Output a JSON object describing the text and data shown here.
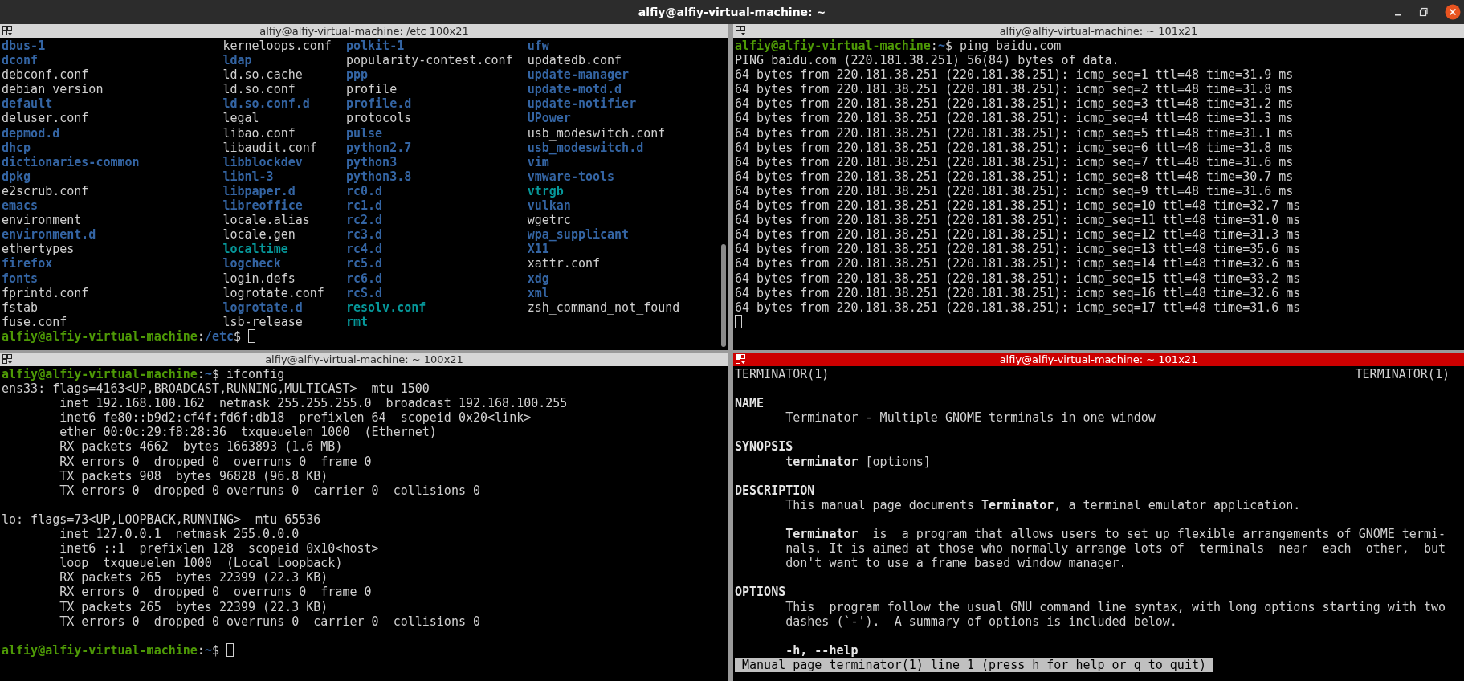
{
  "window": {
    "title": "alfiy@alfiy-virtual-machine: ~"
  },
  "panes": [
    {
      "title": "alfiy@alfiy-virtual-machine: /etc 100x21",
      "focused": false,
      "scrollbar": true,
      "listing": [
        [
          {
            "name": "dbus-1",
            "kind": "dir"
          },
          {
            "name": "kerneloops.conf",
            "kind": "file"
          },
          {
            "name": "polkit-1",
            "kind": "dir"
          },
          {
            "name": "ufw",
            "kind": "dir"
          }
        ],
        [
          {
            "name": "dconf",
            "kind": "dir"
          },
          {
            "name": "ldap",
            "kind": "dir"
          },
          {
            "name": "popularity-contest.conf",
            "kind": "file"
          },
          {
            "name": "updatedb.conf",
            "kind": "file"
          }
        ],
        [
          {
            "name": "debconf.conf",
            "kind": "file"
          },
          {
            "name": "ld.so.cache",
            "kind": "file"
          },
          {
            "name": "ppp",
            "kind": "dir"
          },
          {
            "name": "update-manager",
            "kind": "dir"
          }
        ],
        [
          {
            "name": "debian_version",
            "kind": "file"
          },
          {
            "name": "ld.so.conf",
            "kind": "file"
          },
          {
            "name": "profile",
            "kind": "file"
          },
          {
            "name": "update-motd.d",
            "kind": "dir"
          }
        ],
        [
          {
            "name": "default",
            "kind": "dir"
          },
          {
            "name": "ld.so.conf.d",
            "kind": "dir"
          },
          {
            "name": "profile.d",
            "kind": "dir"
          },
          {
            "name": "update-notifier",
            "kind": "dir"
          }
        ],
        [
          {
            "name": "deluser.conf",
            "kind": "file"
          },
          {
            "name": "legal",
            "kind": "file"
          },
          {
            "name": "protocols",
            "kind": "file"
          },
          {
            "name": "UPower",
            "kind": "dir"
          }
        ],
        [
          {
            "name": "depmod.d",
            "kind": "dir"
          },
          {
            "name": "libao.conf",
            "kind": "file"
          },
          {
            "name": "pulse",
            "kind": "dir"
          },
          {
            "name": "usb_modeswitch.conf",
            "kind": "file"
          }
        ],
        [
          {
            "name": "dhcp",
            "kind": "dir"
          },
          {
            "name": "libaudit.conf",
            "kind": "file"
          },
          {
            "name": "python2.7",
            "kind": "dir"
          },
          {
            "name": "usb_modeswitch.d",
            "kind": "dir"
          }
        ],
        [
          {
            "name": "dictionaries-common",
            "kind": "dir"
          },
          {
            "name": "libblockdev",
            "kind": "dir"
          },
          {
            "name": "python3",
            "kind": "dir"
          },
          {
            "name": "vim",
            "kind": "dir"
          }
        ],
        [
          {
            "name": "dpkg",
            "kind": "dir"
          },
          {
            "name": "libnl-3",
            "kind": "dir"
          },
          {
            "name": "python3.8",
            "kind": "dir"
          },
          {
            "name": "vmware-tools",
            "kind": "dir"
          }
        ],
        [
          {
            "name": "e2scrub.conf",
            "kind": "file"
          },
          {
            "name": "libpaper.d",
            "kind": "dir"
          },
          {
            "name": "rc0.d",
            "kind": "dir"
          },
          {
            "name": "vtrgb",
            "kind": "link"
          }
        ],
        [
          {
            "name": "emacs",
            "kind": "dir"
          },
          {
            "name": "libreoffice",
            "kind": "dir"
          },
          {
            "name": "rc1.d",
            "kind": "dir"
          },
          {
            "name": "vulkan",
            "kind": "dir"
          }
        ],
        [
          {
            "name": "environment",
            "kind": "file"
          },
          {
            "name": "locale.alias",
            "kind": "file"
          },
          {
            "name": "rc2.d",
            "kind": "dir"
          },
          {
            "name": "wgetrc",
            "kind": "file"
          }
        ],
        [
          {
            "name": "environment.d",
            "kind": "dir"
          },
          {
            "name": "locale.gen",
            "kind": "file"
          },
          {
            "name": "rc3.d",
            "kind": "dir"
          },
          {
            "name": "wpa_supplicant",
            "kind": "dir"
          }
        ],
        [
          {
            "name": "ethertypes",
            "kind": "file"
          },
          {
            "name": "localtime",
            "kind": "link"
          },
          {
            "name": "rc4.d",
            "kind": "dir"
          },
          {
            "name": "X11",
            "kind": "dir"
          }
        ],
        [
          {
            "name": "firefox",
            "kind": "dir"
          },
          {
            "name": "logcheck",
            "kind": "dir"
          },
          {
            "name": "rc5.d",
            "kind": "dir"
          },
          {
            "name": "xattr.conf",
            "kind": "file"
          }
        ],
        [
          {
            "name": "fonts",
            "kind": "dir"
          },
          {
            "name": "login.defs",
            "kind": "file"
          },
          {
            "name": "rc6.d",
            "kind": "dir"
          },
          {
            "name": "xdg",
            "kind": "dir"
          }
        ],
        [
          {
            "name": "fprintd.conf",
            "kind": "file"
          },
          {
            "name": "logrotate.conf",
            "kind": "file"
          },
          {
            "name": "rcS.d",
            "kind": "dir"
          },
          {
            "name": "xml",
            "kind": "dir"
          }
        ],
        [
          {
            "name": "fstab",
            "kind": "file"
          },
          {
            "name": "logrotate.d",
            "kind": "dir"
          },
          {
            "name": "resolv.conf",
            "kind": "link"
          },
          {
            "name": "zsh_command_not_found",
            "kind": "file"
          }
        ],
        [
          {
            "name": "fuse.conf",
            "kind": "file"
          },
          {
            "name": "lsb-release",
            "kind": "file"
          },
          {
            "name": "rmt",
            "kind": "link"
          }
        ]
      ],
      "lines": [
        {
          "kind": "prompt",
          "user": "alfiy@alfiy-virtual-machine",
          "separator": ":",
          "path": "/etc",
          "sign": "$",
          "cursor": true
        }
      ]
    },
    {
      "title": "alfiy@alfiy-virtual-machine: ~ 101x21",
      "focused": false,
      "scrollbar": false,
      "lines": [
        {
          "kind": "prompt",
          "user": "alfiy@alfiy-virtual-machine",
          "separator": ":",
          "path": "~",
          "sign": "$",
          "command": "ping baidu.com",
          "cursor": false
        },
        {
          "kind": "plain",
          "text": "PING baidu.com (220.181.38.251) 56(84) bytes of data."
        },
        {
          "kind": "plain",
          "text": "64 bytes from 220.181.38.251 (220.181.38.251): icmp_seq=1 ttl=48 time=31.9 ms"
        },
        {
          "kind": "plain",
          "text": "64 bytes from 220.181.38.251 (220.181.38.251): icmp_seq=2 ttl=48 time=31.8 ms"
        },
        {
          "kind": "plain",
          "text": "64 bytes from 220.181.38.251 (220.181.38.251): icmp_seq=3 ttl=48 time=31.2 ms"
        },
        {
          "kind": "plain",
          "text": "64 bytes from 220.181.38.251 (220.181.38.251): icmp_seq=4 ttl=48 time=31.3 ms"
        },
        {
          "kind": "plain",
          "text": "64 bytes from 220.181.38.251 (220.181.38.251): icmp_seq=5 ttl=48 time=31.1 ms"
        },
        {
          "kind": "plain",
          "text": "64 bytes from 220.181.38.251 (220.181.38.251): icmp_seq=6 ttl=48 time=31.8 ms"
        },
        {
          "kind": "plain",
          "text": "64 bytes from 220.181.38.251 (220.181.38.251): icmp_seq=7 ttl=48 time=31.6 ms"
        },
        {
          "kind": "plain",
          "text": "64 bytes from 220.181.38.251 (220.181.38.251): icmp_seq=8 ttl=48 time=30.7 ms"
        },
        {
          "kind": "plain",
          "text": "64 bytes from 220.181.38.251 (220.181.38.251): icmp_seq=9 ttl=48 time=31.6 ms"
        },
        {
          "kind": "plain",
          "text": "64 bytes from 220.181.38.251 (220.181.38.251): icmp_seq=10 ttl=48 time=32.7 ms"
        },
        {
          "kind": "plain",
          "text": "64 bytes from 220.181.38.251 (220.181.38.251): icmp_seq=11 ttl=48 time=31.0 ms"
        },
        {
          "kind": "plain",
          "text": "64 bytes from 220.181.38.251 (220.181.38.251): icmp_seq=12 ttl=48 time=31.3 ms"
        },
        {
          "kind": "plain",
          "text": "64 bytes from 220.181.38.251 (220.181.38.251): icmp_seq=13 ttl=48 time=35.6 ms"
        },
        {
          "kind": "plain",
          "text": "64 bytes from 220.181.38.251 (220.181.38.251): icmp_seq=14 ttl=48 time=32.6 ms"
        },
        {
          "kind": "plain",
          "text": "64 bytes from 220.181.38.251 (220.181.38.251): icmp_seq=15 ttl=48 time=33.2 ms"
        },
        {
          "kind": "plain",
          "text": "64 bytes from 220.181.38.251 (220.181.38.251): icmp_seq=16 ttl=48 time=32.6 ms"
        },
        {
          "kind": "plain",
          "text": "64 bytes from 220.181.38.251 (220.181.38.251): icmp_seq=17 ttl=48 time=31.6 ms"
        },
        {
          "kind": "cursor"
        }
      ]
    },
    {
      "title": "alfiy@alfiy-virtual-machine: ~ 100x21",
      "focused": false,
      "scrollbar": false,
      "lines": [
        {
          "kind": "prompt",
          "user": "alfiy@alfiy-virtual-machine",
          "separator": ":",
          "path": "~",
          "sign": "$",
          "command": "ifconfig",
          "cursor": false
        },
        {
          "kind": "plain",
          "text": "ens33: flags=4163<UP,BROADCAST,RUNNING,MULTICAST>  mtu 1500"
        },
        {
          "kind": "tabbed",
          "text": "inet 192.168.100.162  netmask 255.255.255.0  broadcast 192.168.100.255"
        },
        {
          "kind": "tabbed",
          "text": "inet6 fe80::b9d2:cf4f:fd6f:db18  prefixlen 64  scopeid 0x20<link>"
        },
        {
          "kind": "tabbed",
          "text": "ether 00:0c:29:f8:28:36  txqueuelen 1000  (Ethernet)"
        },
        {
          "kind": "tabbed",
          "text": "RX packets 4662  bytes 1663893 (1.6 MB)"
        },
        {
          "kind": "tabbed",
          "text": "RX errors 0  dropped 0  overruns 0  frame 0"
        },
        {
          "kind": "tabbed",
          "text": "TX packets 908  bytes 96828 (96.8 KB)"
        },
        {
          "kind": "tabbed",
          "text": "TX errors 0  dropped 0 overruns 0  carrier 0  collisions 0"
        },
        {
          "kind": "blank"
        },
        {
          "kind": "plain",
          "text": "lo: flags=73<UP,LOOPBACK,RUNNING>  mtu 65536"
        },
        {
          "kind": "tabbed",
          "text": "inet 127.0.0.1  netmask 255.0.0.0"
        },
        {
          "kind": "tabbed",
          "text": "inet6 ::1  prefixlen 128  scopeid 0x10<host>"
        },
        {
          "kind": "tabbed",
          "text": "loop  txqueuelen 1000  (Local Loopback)"
        },
        {
          "kind": "tabbed",
          "text": "RX packets 265  bytes 22399 (22.3 KB)"
        },
        {
          "kind": "tabbed",
          "text": "RX errors 0  dropped 0  overruns 0  frame 0"
        },
        {
          "kind": "tabbed",
          "text": "TX packets 265  bytes 22399 (22.3 KB)"
        },
        {
          "kind": "tabbed",
          "text": "TX errors 0  dropped 0 overruns 0  carrier 0  collisions 0"
        },
        {
          "kind": "blank"
        },
        {
          "kind": "prompt",
          "user": "alfiy@alfiy-virtual-machine",
          "separator": ":",
          "path": "~",
          "sign": "$",
          "cursor": true
        }
      ]
    },
    {
      "title": "alfiy@alfiy-virtual-machine: ~ 101x21",
      "focused": true,
      "scrollbar": false,
      "lines": [
        {
          "kind": "header",
          "left": "TERMINATOR(1)",
          "right": "TERMINATOR(1)"
        },
        {
          "kind": "blank"
        },
        {
          "kind": "heading",
          "text": "NAME"
        },
        {
          "kind": "indented",
          "segments": [
            {
              "text": "Terminator - Multiple GNOME terminals in one window",
              "kind": "plain"
            }
          ]
        },
        {
          "kind": "blank"
        },
        {
          "kind": "heading",
          "text": "SYNOPSIS"
        },
        {
          "kind": "indented",
          "segments": [
            {
              "text": "terminator",
              "kind": "bold"
            },
            {
              "text": " [",
              "kind": "plain"
            },
            {
              "text": "options",
              "kind": "underline"
            },
            {
              "text": "]",
              "kind": "plain"
            }
          ]
        },
        {
          "kind": "blank"
        },
        {
          "kind": "heading",
          "text": "DESCRIPTION"
        },
        {
          "kind": "indented",
          "segments": [
            {
              "text": "This manual page documents ",
              "kind": "plain"
            },
            {
              "text": "Terminator",
              "kind": "bold"
            },
            {
              "text": ", a terminal emulator application.",
              "kind": "plain"
            }
          ]
        },
        {
          "kind": "blank"
        },
        {
          "kind": "indented",
          "segments": [
            {
              "text": "Terminator",
              "kind": "bold"
            },
            {
              "text": "  is  a program that allows users to set up flexible arrangements of GNOME termi-",
              "kind": "plain"
            }
          ]
        },
        {
          "kind": "indented",
          "segments": [
            {
              "text": "nals. It is aimed at those who normally arrange lots of  terminals  near  each  other,  but",
              "kind": "plain"
            }
          ]
        },
        {
          "kind": "indented",
          "segments": [
            {
              "text": "don't want to use a frame based window manager.",
              "kind": "plain"
            }
          ]
        },
        {
          "kind": "blank"
        },
        {
          "kind": "heading",
          "text": "OPTIONS"
        },
        {
          "kind": "indented",
          "segments": [
            {
              "text": "This  program follow the usual GNU command line syntax, with long options starting with two",
              "kind": "plain"
            }
          ]
        },
        {
          "kind": "indented",
          "segments": [
            {
              "text": "dashes (`-').  A summary of options is included below.",
              "kind": "plain"
            }
          ]
        },
        {
          "kind": "blank"
        },
        {
          "kind": "indented",
          "segments": [
            {
              "text": "-h, --help",
              "kind": "bold"
            }
          ]
        },
        {
          "kind": "status",
          "text": "Manual page terminator(1) line 1 (press h for help or q to quit)"
        }
      ]
    }
  ]
}
